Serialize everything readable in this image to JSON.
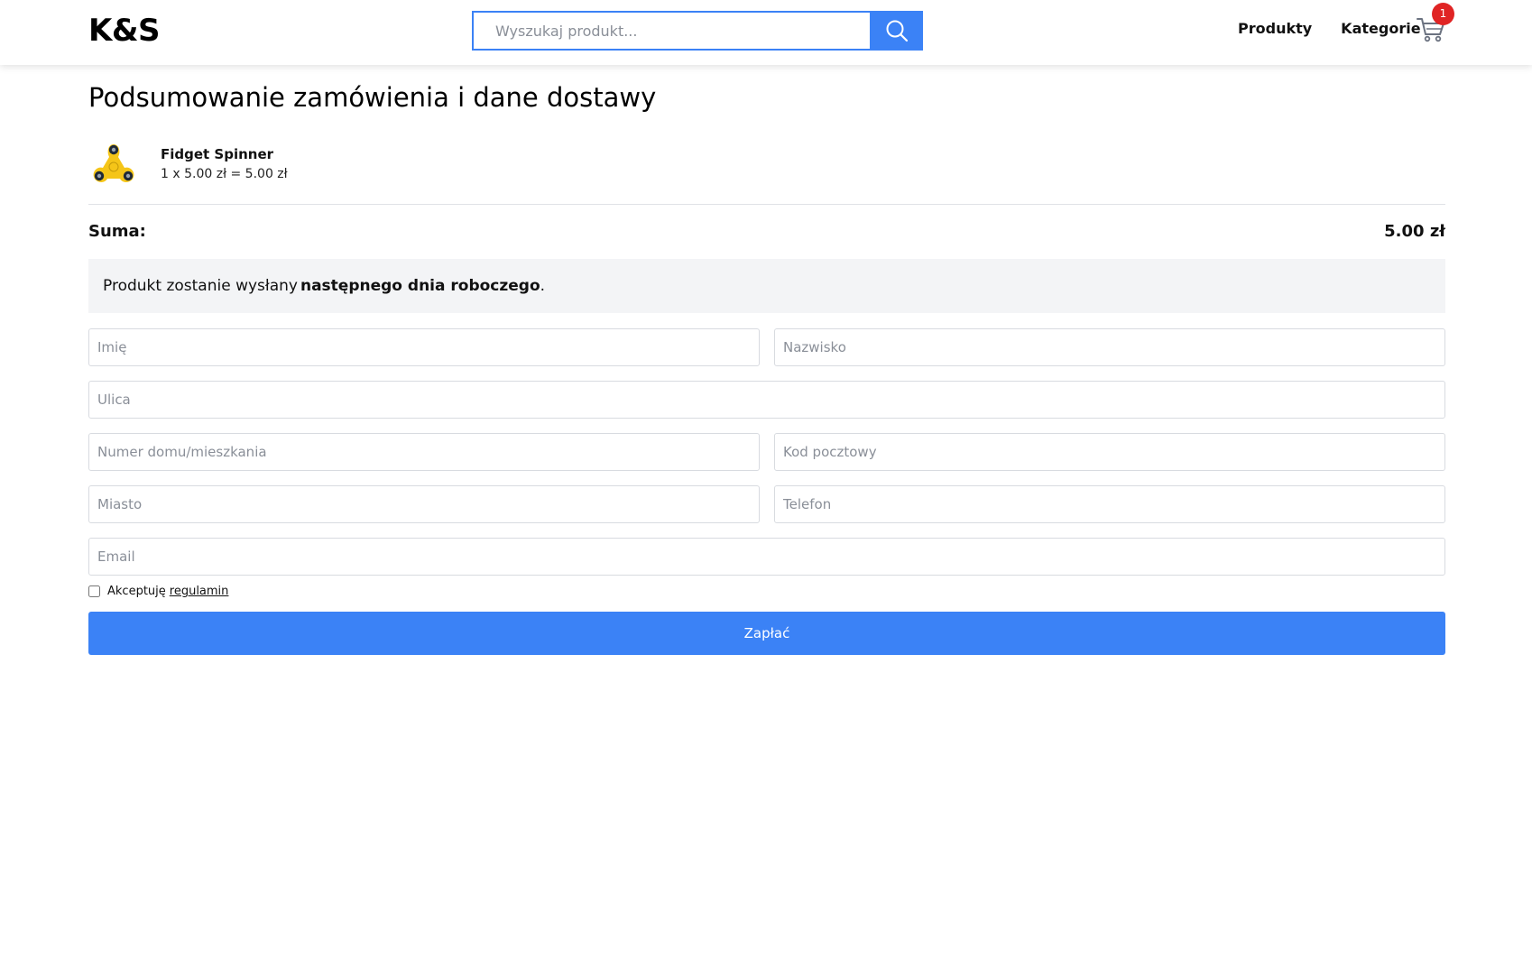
{
  "header": {
    "logo": "K&S",
    "search_placeholder": "Wyszukaj produkt...",
    "nav": [
      "Produkty",
      "Kategorie"
    ],
    "cart_count": "1",
    "accent_color": "#3b82f6",
    "badge_color": "#e02424"
  },
  "page": {
    "title": "Podsumowanie zamówienia i dane dostawy"
  },
  "order": {
    "items": [
      {
        "name": "Fidget Spinner",
        "line": "1 x 5.00 zł = 5.00 zł",
        "icon": "fidget-spinner-icon"
      }
    ],
    "sum_label": "Suma:",
    "sum_value": "5.00 zł"
  },
  "notice": {
    "prefix": "Produkt zostanie wysłany",
    "bold": "następnego dnia roboczego",
    "suffix": "."
  },
  "form": {
    "first_name_placeholder": "Imię",
    "last_name_placeholder": "Nazwisko",
    "street_placeholder": "Ulica",
    "house_number_placeholder": "Numer domu/mieszkania",
    "postal_code_placeholder": "Kod pocztowy",
    "city_placeholder": "Miasto",
    "phone_placeholder": "Telefon",
    "email_placeholder": "Email",
    "terms_label": "Akceptuję",
    "terms_link": "regulamin",
    "pay_label": "Zapłać"
  }
}
